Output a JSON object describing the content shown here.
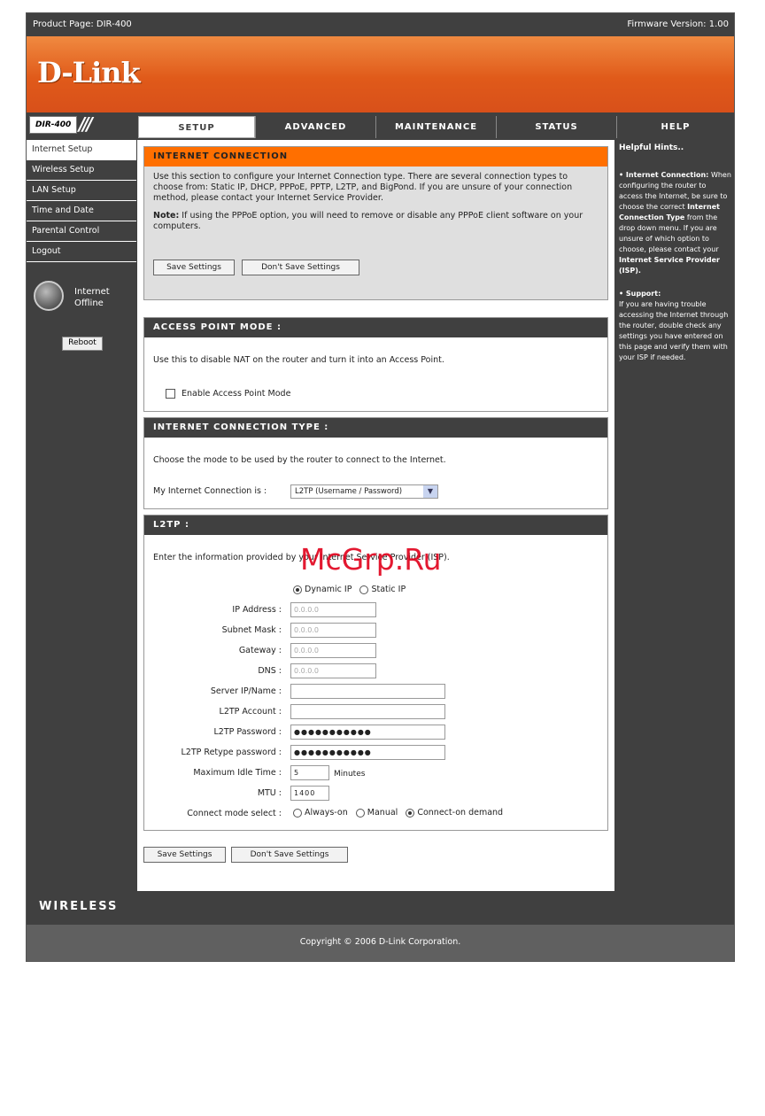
{
  "topbar": {
    "product": "Product Page: DIR-400",
    "firmware": "Firmware Version: 1.00"
  },
  "logo": "D-Link",
  "model": "DIR-400",
  "tabs": [
    "SETUP",
    "ADVANCED",
    "MAINTENANCE",
    "STATUS",
    "HELP"
  ],
  "sidebar": {
    "items": [
      "Internet Setup",
      "Wireless Setup",
      "LAN Setup",
      "Time and Date",
      "Parental Control",
      "Logout"
    ],
    "status_line1": "Internet",
    "status_line2": "Offline",
    "reboot": "Reboot"
  },
  "internet_connection": {
    "title": "INTERNET CONNECTION",
    "description": "Use this section to configure your Internet Connection type. There are several connection types to choose from: Static IP, DHCP, PPPoE, PPTP, L2TP, and BigPond. If you are unsure of your connection method, please contact your Internet Service Provider.",
    "note_label": "Note:",
    "note_text": " If using the PPPoE option, you will need to remove or disable any PPPoE client software on your computers.",
    "save": "Save Settings",
    "dont_save": "Don't Save Settings"
  },
  "access_point": {
    "title": "ACCESS POINT MODE :",
    "description": "Use this to disable NAT on the router and turn it into an Access Point.",
    "checkbox_label": "Enable Access Point Mode"
  },
  "connection_type": {
    "title": "INTERNET CONNECTION TYPE :",
    "description": "Choose the mode to be used by the router to connect to the Internet.",
    "label": "My Internet Connection is :",
    "selected": "L2TP (Username / Password)"
  },
  "l2tp": {
    "title": "L2TP :",
    "description": "Enter the information provided by your Internet Service Provider (ISP).",
    "dynamic_ip": "Dynamic IP",
    "static_ip": "Static IP",
    "ip_label": "IP Address :",
    "ip_value": "0.0.0.0",
    "subnet_label": "Subnet Mask :",
    "subnet_value": "0.0.0.0",
    "gateway_label": "Gateway :",
    "gateway_value": "0.0.0.0",
    "dns_label": "DNS :",
    "dns_value": "0.0.0.0",
    "server_label": "Server IP/Name :",
    "server_value": "",
    "account_label": "L2TP Account :",
    "account_value": "",
    "password_label": "L2TP Password :",
    "password_value": "●●●●●●●●●●●",
    "retype_label": "L2TP Retype password :",
    "retype_value": "●●●●●●●●●●●",
    "idle_label": "Maximum Idle Time :",
    "idle_value": "5",
    "idle_unit": "Minutes",
    "mtu_label": "MTU :",
    "mtu_value": "1400",
    "mode_label": "Connect mode select :",
    "mode_always": "Always-on",
    "mode_manual": "Manual",
    "mode_demand": "Connect-on demand"
  },
  "bottom_buttons": {
    "save": "Save Settings",
    "dont_save": "Don't Save Settings"
  },
  "help": {
    "title": "Helpful Hints..",
    "ic_title": "• Internet Connection:",
    "ic_text1": "When configuring the router to access the Internet, be sure to choose the correct ",
    "ic_bold1": "Internet Connection Type",
    "ic_text2": " from the drop down menu. If you are unsure of which option to choose, please contact your ",
    "ic_bold2": "Internet Service Provider (ISP).",
    "support_title": "• Support:",
    "support_text": "If you are having trouble accessing the Internet through the router, double check any settings you have entered on this page and verify them with your ISP if needed."
  },
  "footer": {
    "wireless": "WIRELESS",
    "copyright": "Copyright © 2006 D-Link Corporation."
  },
  "watermark": "McGrp.Ru",
  "colors": {
    "accent": "#ff6f00",
    "dark": "#404040",
    "banner": "#e05a1a"
  }
}
